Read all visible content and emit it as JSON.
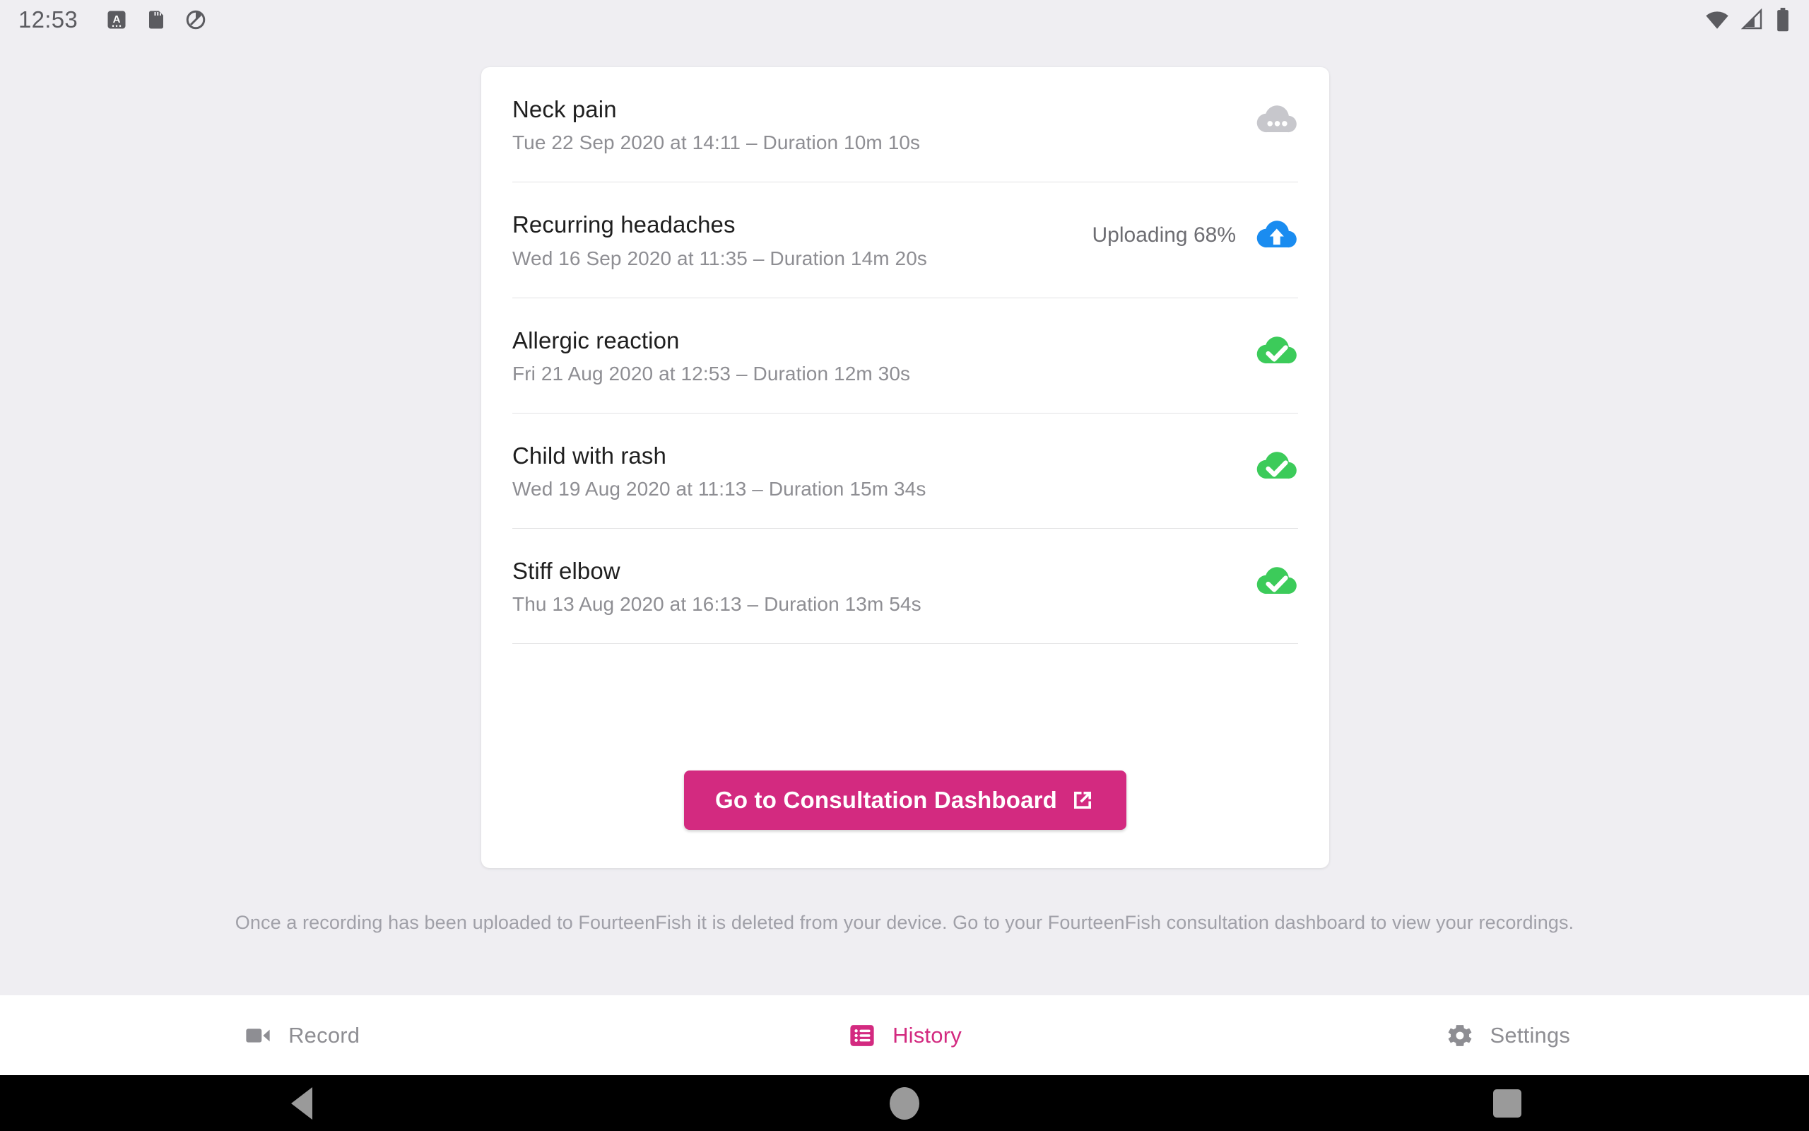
{
  "status_bar": {
    "clock": "12:53",
    "left_icons": [
      "alarm-a-icon",
      "sd-card-icon",
      "do-not-disturb-icon"
    ],
    "right_icons": [
      "wifi-icon",
      "cellular-signal-icon",
      "battery-icon"
    ]
  },
  "card": {
    "recordings": [
      {
        "title": "Neck pain",
        "subtitle": "Tue 22 Sep 2020 at 14:11 – Duration 10m 10s",
        "status": "pending",
        "status_icon": "cloud-pending-icon",
        "status_text": "",
        "icon_color": "#c7c7cc"
      },
      {
        "title": "Recurring headaches",
        "subtitle": "Wed 16 Sep 2020 at 11:35 – Duration 14m 20s",
        "status": "uploading",
        "status_icon": "cloud-upload-icon",
        "status_text": "Uploading 68%",
        "icon_color": "#1a8cf0"
      },
      {
        "title": "Allergic reaction",
        "subtitle": "Fri 21 Aug 2020 at 12:53 – Duration 12m 30s",
        "status": "uploaded",
        "status_icon": "cloud-done-icon",
        "status_text": "",
        "icon_color": "#3ccb5a"
      },
      {
        "title": "Child with rash",
        "subtitle": "Wed 19 Aug 2020 at 11:13 – Duration 15m 34s",
        "status": "uploaded",
        "status_icon": "cloud-done-icon",
        "status_text": "",
        "icon_color": "#3ccb5a"
      },
      {
        "title": "Stiff elbow",
        "subtitle": "Thu 13 Aug 2020 at 16:13 – Duration 13m 54s",
        "status": "uploaded",
        "status_icon": "cloud-done-icon",
        "status_text": "",
        "icon_color": "#3ccb5a"
      }
    ],
    "cta": {
      "label": "Go to Consultation Dashboard",
      "icon": "external-link-icon",
      "color": "#d32a80"
    }
  },
  "footer_note": "Once a recording has been uploaded to FourteenFish it is deleted from your device. Go to your FourteenFish consultation dashboard to view your recordings.",
  "tab_bar": {
    "accent_color": "#d32a80",
    "inactive_color": "#8e8e93",
    "tabs": [
      {
        "label": "Record",
        "icon": "video-camera-icon",
        "active": false
      },
      {
        "label": "History",
        "icon": "list-icon",
        "active": true
      },
      {
        "label": "Settings",
        "icon": "gear-icon",
        "active": false
      }
    ]
  },
  "nav_bar": {
    "buttons": [
      {
        "name": "back-button",
        "icon": "triangle-back-icon"
      },
      {
        "name": "home-button",
        "icon": "circle-home-icon"
      },
      {
        "name": "recents-button",
        "icon": "square-recents-icon"
      }
    ]
  }
}
